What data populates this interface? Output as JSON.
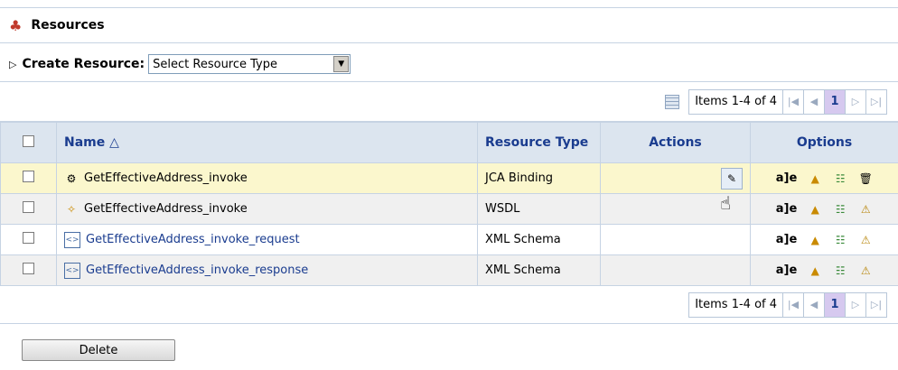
{
  "header": {
    "title": "Resources",
    "icon": "resources-icon"
  },
  "create": {
    "label": "Create Resource:",
    "select_value": "Select Resource Type"
  },
  "pager": {
    "items_text": "Items 1-4 of 4",
    "page": "1"
  },
  "columns": {
    "name": "Name",
    "sort_indicator": "△",
    "resource_type": "Resource Type",
    "actions": "Actions",
    "options": "Options"
  },
  "rows": [
    {
      "name": "GetEffectiveAddress_invoke",
      "type": "JCA Binding",
      "icon": "jca-binding-icon",
      "link": false
    },
    {
      "name": "GetEffectiveAddress_invoke",
      "type": "WSDL",
      "icon": "wsdl-icon",
      "link": false
    },
    {
      "name": "GetEffectiveAddress_invoke_request",
      "type": "XML Schema",
      "icon": "xml-schema-icon",
      "link": true
    },
    {
      "name": "GetEffectiveAddress_invoke_response",
      "type": "XML Schema",
      "icon": "xml-schema-icon",
      "link": true
    }
  ],
  "option_rename_label": "a]e",
  "footer": {
    "delete_label": "Delete"
  },
  "colors": {
    "header_bg": "#dce5ef",
    "link": "#1a3c8f",
    "selected_row": "#fbf7cd",
    "page_active": "#d6c9ef"
  }
}
